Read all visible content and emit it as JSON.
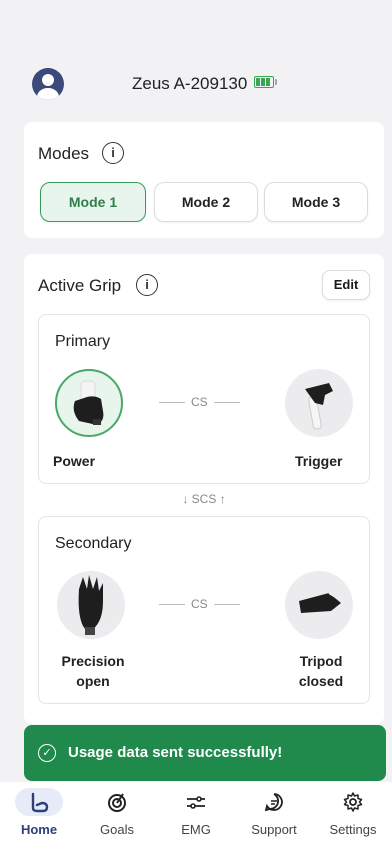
{
  "header": {
    "device_name": "Zeus A-209130"
  },
  "modes": {
    "title": "Modes",
    "items": [
      {
        "label": "Mode 1",
        "active": true
      },
      {
        "label": "Mode 2",
        "active": false
      },
      {
        "label": "Mode 3",
        "active": false
      }
    ]
  },
  "active_grip": {
    "title": "Active Grip",
    "edit_label": "Edit",
    "primary": {
      "title": "Primary",
      "left_grip": "Power",
      "right_grip": "Trigger",
      "connector": "CS"
    },
    "switch_label": "SCS",
    "secondary": {
      "title": "Secondary",
      "left_grip_line1": "Precision",
      "left_grip_line2": "open",
      "right_grip_line1": "Tripod",
      "right_grip_line2": "closed",
      "connector": "CS"
    }
  },
  "toast": {
    "message": "Usage data sent successfully!"
  },
  "tabs": [
    {
      "label": "Home",
      "icon": "home-icon",
      "active": true
    },
    {
      "label": "Goals",
      "icon": "goals-icon",
      "active": false
    },
    {
      "label": "EMG",
      "icon": "emg-icon",
      "active": false
    },
    {
      "label": "Support",
      "icon": "support-icon",
      "active": false
    },
    {
      "label": "Settings",
      "icon": "gear-icon",
      "active": false
    }
  ],
  "colors": {
    "accent": "#2e3f78",
    "success": "#1f8a4c",
    "active_mode": "#3a9a5a"
  }
}
